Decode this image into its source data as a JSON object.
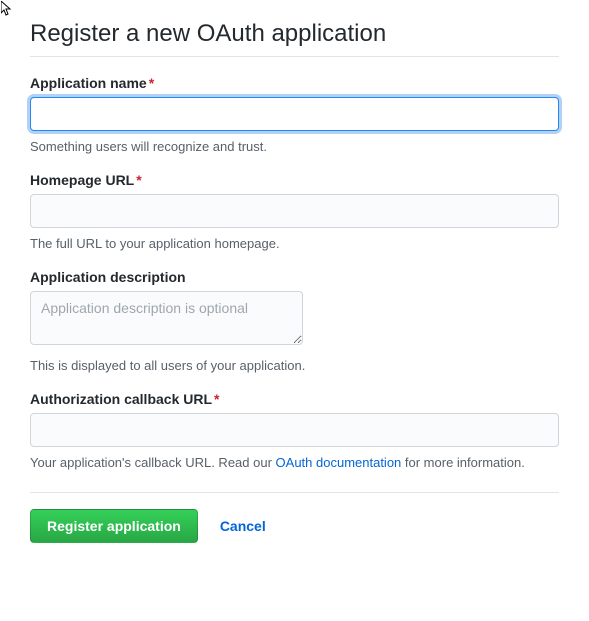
{
  "page": {
    "title": "Register a new OAuth application"
  },
  "fields": {
    "appName": {
      "label": "Application name",
      "required_marker": "*",
      "value": "",
      "help": "Something users will recognize and trust."
    },
    "homepage": {
      "label": "Homepage URL",
      "required_marker": "*",
      "value": "",
      "help": "The full URL to your application homepage."
    },
    "description": {
      "label": "Application description",
      "placeholder": "Application description is optional",
      "value": "",
      "help": "This is displayed to all users of your application."
    },
    "callback": {
      "label": "Authorization callback URL",
      "required_marker": "*",
      "value": "",
      "help_prefix": "Your application's callback URL. Read our ",
      "help_link": "OAuth documentation",
      "help_suffix": " for more information."
    }
  },
  "actions": {
    "submit": "Register application",
    "cancel": "Cancel"
  }
}
